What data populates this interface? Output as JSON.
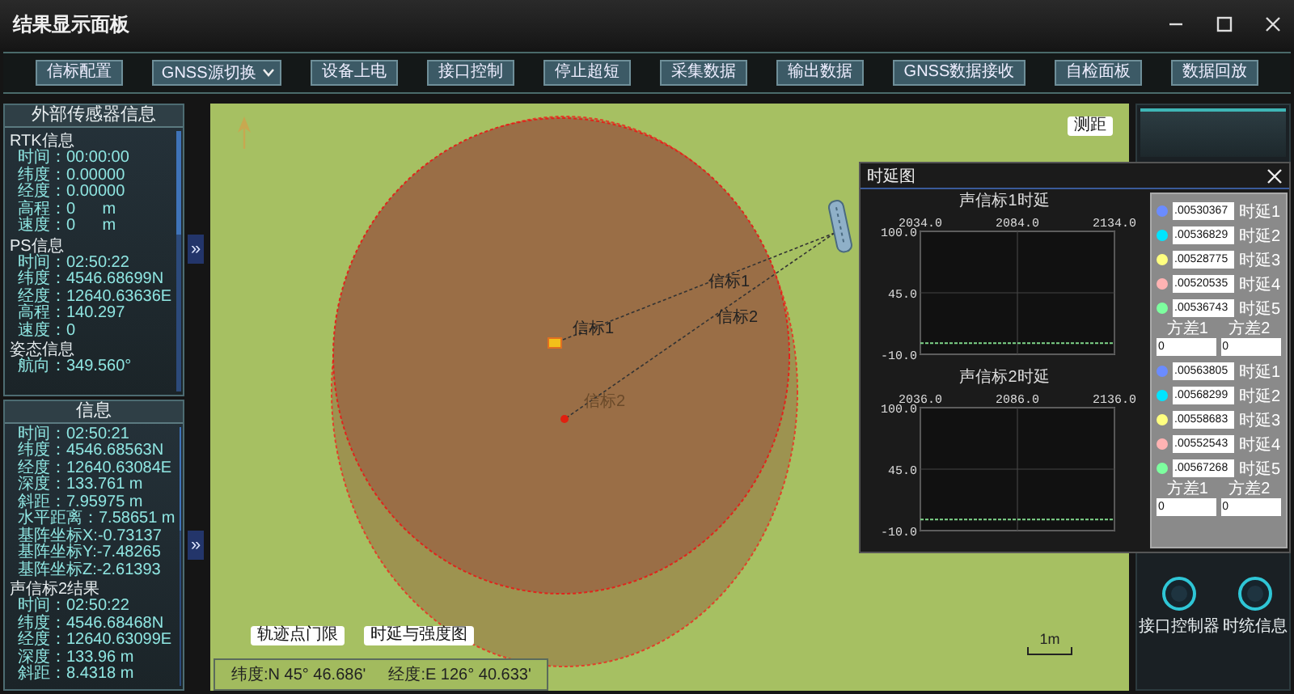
{
  "window": {
    "title": "结果显示面板"
  },
  "toolbar": [
    {
      "kind": "button",
      "label": "信标配置"
    },
    {
      "kind": "dropdown",
      "label": "GNSS源切换"
    },
    {
      "kind": "button",
      "label": "设备上电"
    },
    {
      "kind": "button",
      "label": "接口控制"
    },
    {
      "kind": "button",
      "label": "停止超短"
    },
    {
      "kind": "button",
      "label": "采集数据"
    },
    {
      "kind": "button",
      "label": "输出数据"
    },
    {
      "kind": "button",
      "label": "GNSS数据接收"
    },
    {
      "kind": "button",
      "label": "自检面板"
    },
    {
      "kind": "button",
      "label": "数据回放"
    }
  ],
  "side_panels": [
    {
      "title": "外部传感器信息",
      "expand": "»",
      "sections": [
        {
          "heading": "RTK信息",
          "lines": [
            "时间：00:00:00",
            "纬度：0.00000",
            "经度：0.00000",
            "高程：0      m",
            "速度：0      m"
          ]
        },
        {
          "heading": "PS信息",
          "lines": [
            "时间：02:50:22",
            "纬度：4546.68699N",
            "经度：12640.63636E",
            "高程：140.297",
            "速度：0"
          ]
        },
        {
          "heading": "姿态信息",
          "lines": [
            "航向：349.560°"
          ]
        }
      ]
    },
    {
      "title": "信息",
      "expand": "»",
      "sections": [
        {
          "lines": [
            "时间：02:50:21",
            "纬度：4546.68563N",
            "经度：12640.63084E",
            "深度：133.761 m",
            "斜距：7.95975 m",
            "水平距离：7.58651 m",
            "基阵坐标X:-0.73137",
            "基阵坐标Y:-7.48265",
            "基阵坐标Z:-2.61393"
          ]
        },
        {
          "heading": "声信标2结果",
          "lines": [
            "时间：02:50:22",
            "纬度：4546.68468N",
            "经度：12640.63099E",
            "深度：133.96 m",
            "斜距：8.4318 m"
          ]
        }
      ]
    }
  ],
  "map": {
    "distance_button": "测距",
    "line_labels": [
      "信标1",
      "信标2"
    ],
    "point_labels": [
      "信标1",
      "信标2"
    ],
    "buttons": [
      "轨迹点门限",
      "时延与强度图"
    ],
    "latitude": "纬度:N 45° 46.686'",
    "longitude": "经度:E 126° 40.633'",
    "scale": "1m"
  },
  "delay_dialog": {
    "title": "时延图",
    "charts": [
      {
        "chart_data": {
          "type": "line",
          "title": "声信标1时延",
          "x": [
            2034,
            2134
          ],
          "series": [
            {
              "color": "#7fd68a",
              "line_style": "dashed",
              "values": [
                0,
                0
              ]
            }
          ],
          "xlim": [
            2034,
            2134
          ],
          "ylim": [
            -10,
            100
          ],
          "xticks": [
            {
              "value": 2034,
              "label": "2034.0"
            },
            {
              "value": 2084,
              "label": "2084.0"
            },
            {
              "value": 2134,
              "label": "2134.0"
            }
          ],
          "yticks": [
            {
              "value": 100,
              "label": "100.0"
            },
            {
              "value": 45,
              "label": "45.0"
            },
            {
              "value": -10,
              "label": "-10.0"
            }
          ]
        }
      },
      {
        "chart_data": {
          "type": "line",
          "title": "声信标2时延",
          "x": [
            2036,
            2136
          ],
          "series": [
            {
              "color": "#7fd68a",
              "line_style": "dashed",
              "values": [
                0,
                0
              ]
            }
          ],
          "xlim": [
            2036,
            2136
          ],
          "ylim": [
            -10,
            100
          ],
          "xticks": [
            {
              "value": 2036,
              "label": "2036.0"
            },
            {
              "value": 2086,
              "label": "2086.0"
            },
            {
              "value": 2136,
              "label": "2136.0"
            }
          ],
          "yticks": [
            {
              "value": 100,
              "label": "100.0"
            },
            {
              "value": 45,
              "label": "45.0"
            },
            {
              "value": -10,
              "label": "-10.0"
            }
          ]
        }
      }
    ],
    "groups": [
      {
        "rows": [
          {
            "color": "#6b8cff",
            "value": ".00530367",
            "label": "时延1"
          },
          {
            "color": "#00e5ff",
            "value": ".00536829",
            "label": "时延2"
          },
          {
            "color": "#ffff80",
            "value": ".00528775",
            "label": "时延3"
          },
          {
            "color": "#ffb3b3",
            "value": ".00520535",
            "label": "时延4"
          },
          {
            "color": "#7dff9f",
            "value": ".00536743",
            "label": "时延5"
          }
        ],
        "variance_labels": [
          "方差1",
          "方差2"
        ],
        "variance_values": [
          "0",
          "0"
        ]
      },
      {
        "rows": [
          {
            "color": "#6b8cff",
            "value": ".00563805",
            "label": "时延1"
          },
          {
            "color": "#00e5ff",
            "value": ".00568299",
            "label": "时延2"
          },
          {
            "color": "#ffff80",
            "value": ".00558683",
            "label": "时延3"
          },
          {
            "color": "#ffb3b3",
            "value": ".00552543",
            "label": "时延4"
          },
          {
            "color": "#7dff9f",
            "value": ".00567268",
            "label": "时延5"
          }
        ],
        "variance_labels": [
          "方差1",
          "方差2"
        ],
        "variance_values": [
          "0",
          "0"
        ]
      }
    ]
  },
  "right_panel": {
    "buttons": [
      "接口控制器",
      "时统信息"
    ]
  }
}
